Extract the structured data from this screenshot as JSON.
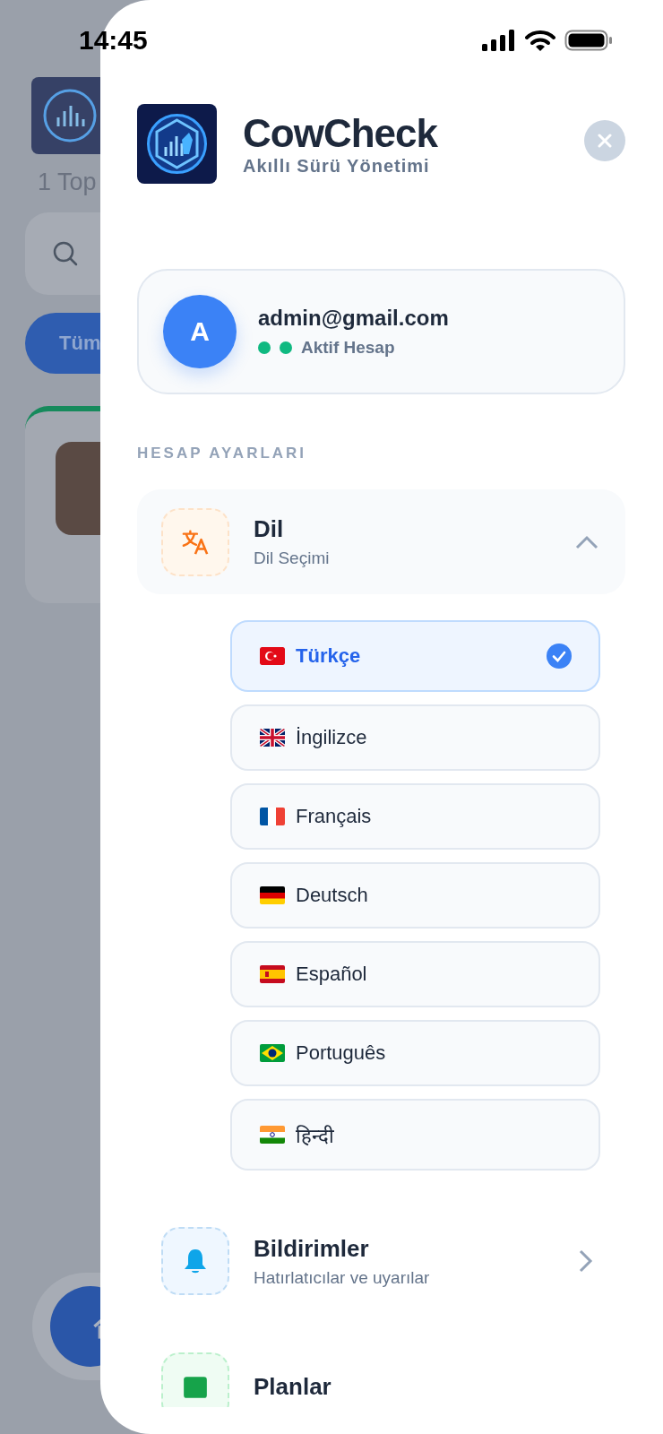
{
  "status_bar": {
    "time": "14:45"
  },
  "background": {
    "count_text": "1 Top",
    "filter_chip": "Tüm"
  },
  "drawer": {
    "app_name": "CowCheck",
    "tagline": "Akıllı Sürü Yönetimi",
    "account": {
      "initial": "A",
      "email": "admin@gmail.com",
      "status": "Aktif Hesap"
    },
    "section_title": "HESAP AYARLARI",
    "menu": [
      {
        "kind": "language",
        "title": "Dil",
        "subtitle": "Dil Seçimi",
        "expanded": true,
        "options": [
          {
            "label": "Türkçe",
            "kind": "tr",
            "selected": true
          },
          {
            "label": "İngilizce",
            "kind": "gb",
            "selected": false
          },
          {
            "label": "Français",
            "kind": "fr",
            "selected": false
          },
          {
            "label": "Deutsch",
            "kind": "de",
            "selected": false
          },
          {
            "label": "Español",
            "kind": "es",
            "selected": false
          },
          {
            "label": "Português",
            "kind": "br",
            "selected": false
          },
          {
            "label": "हिन्दी",
            "kind": "in",
            "selected": false
          }
        ]
      },
      {
        "kind": "notifications",
        "title": "Bildirimler",
        "subtitle": "Hatırlatıcılar ve uyarılar",
        "expanded": false
      },
      {
        "kind": "plans",
        "title": "Planlar"
      }
    ]
  }
}
